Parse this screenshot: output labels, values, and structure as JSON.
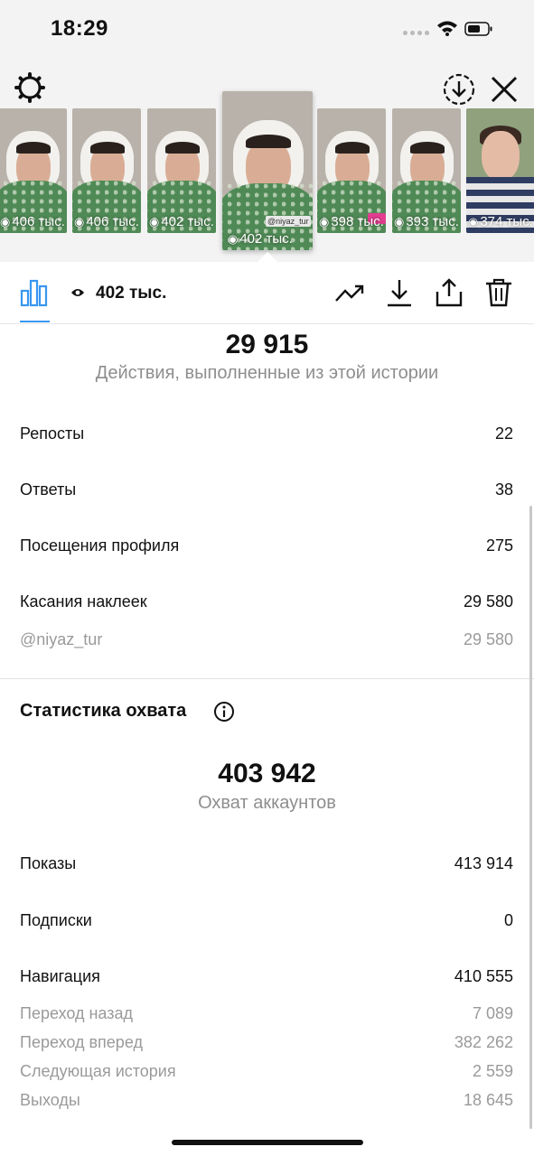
{
  "status_bar": {
    "time": "18:29"
  },
  "thumbnails": [
    {
      "views": "406 тыс."
    },
    {
      "views": "406 тыс."
    },
    {
      "views": "402 тыс."
    },
    {
      "views": "402 тыс.",
      "tag": "@niyaz_tur"
    },
    {
      "views": "398 тыс."
    },
    {
      "views": "393 тыс."
    },
    {
      "views": "374 тыс."
    }
  ],
  "toolbar": {
    "views_total": "402 тыс."
  },
  "interactions": {
    "total": "29 915",
    "caption": "Действия, выполненные из этой истории",
    "rows": [
      {
        "label": "Репосты",
        "value": "22"
      },
      {
        "label": "Ответы",
        "value": "38"
      },
      {
        "label": "Посещения профиля",
        "value": "275"
      },
      {
        "label": "Касания наклеек",
        "value": "29 580"
      }
    ],
    "sub_rows": [
      {
        "label": "@niyaz_tur",
        "value": "29 580"
      }
    ]
  },
  "reach": {
    "section_title": "Статистика охвата",
    "total": "403 942",
    "caption": "Охват аккаунтов",
    "rows": [
      {
        "label": "Показы",
        "value": "413 914"
      },
      {
        "label": "Подписки",
        "value": "0"
      },
      {
        "label": "Навигация",
        "value": "410 555"
      }
    ],
    "sub_rows": [
      {
        "label": "Переход назад",
        "value": "7 089"
      },
      {
        "label": "Переход вперед",
        "value": "382 262"
      },
      {
        "label": "Следующая история",
        "value": "2 559"
      },
      {
        "label": "Выходы",
        "value": "18 645"
      }
    ]
  },
  "colors": {
    "accent": "#3897f0",
    "muted": "#8e8e8e"
  }
}
